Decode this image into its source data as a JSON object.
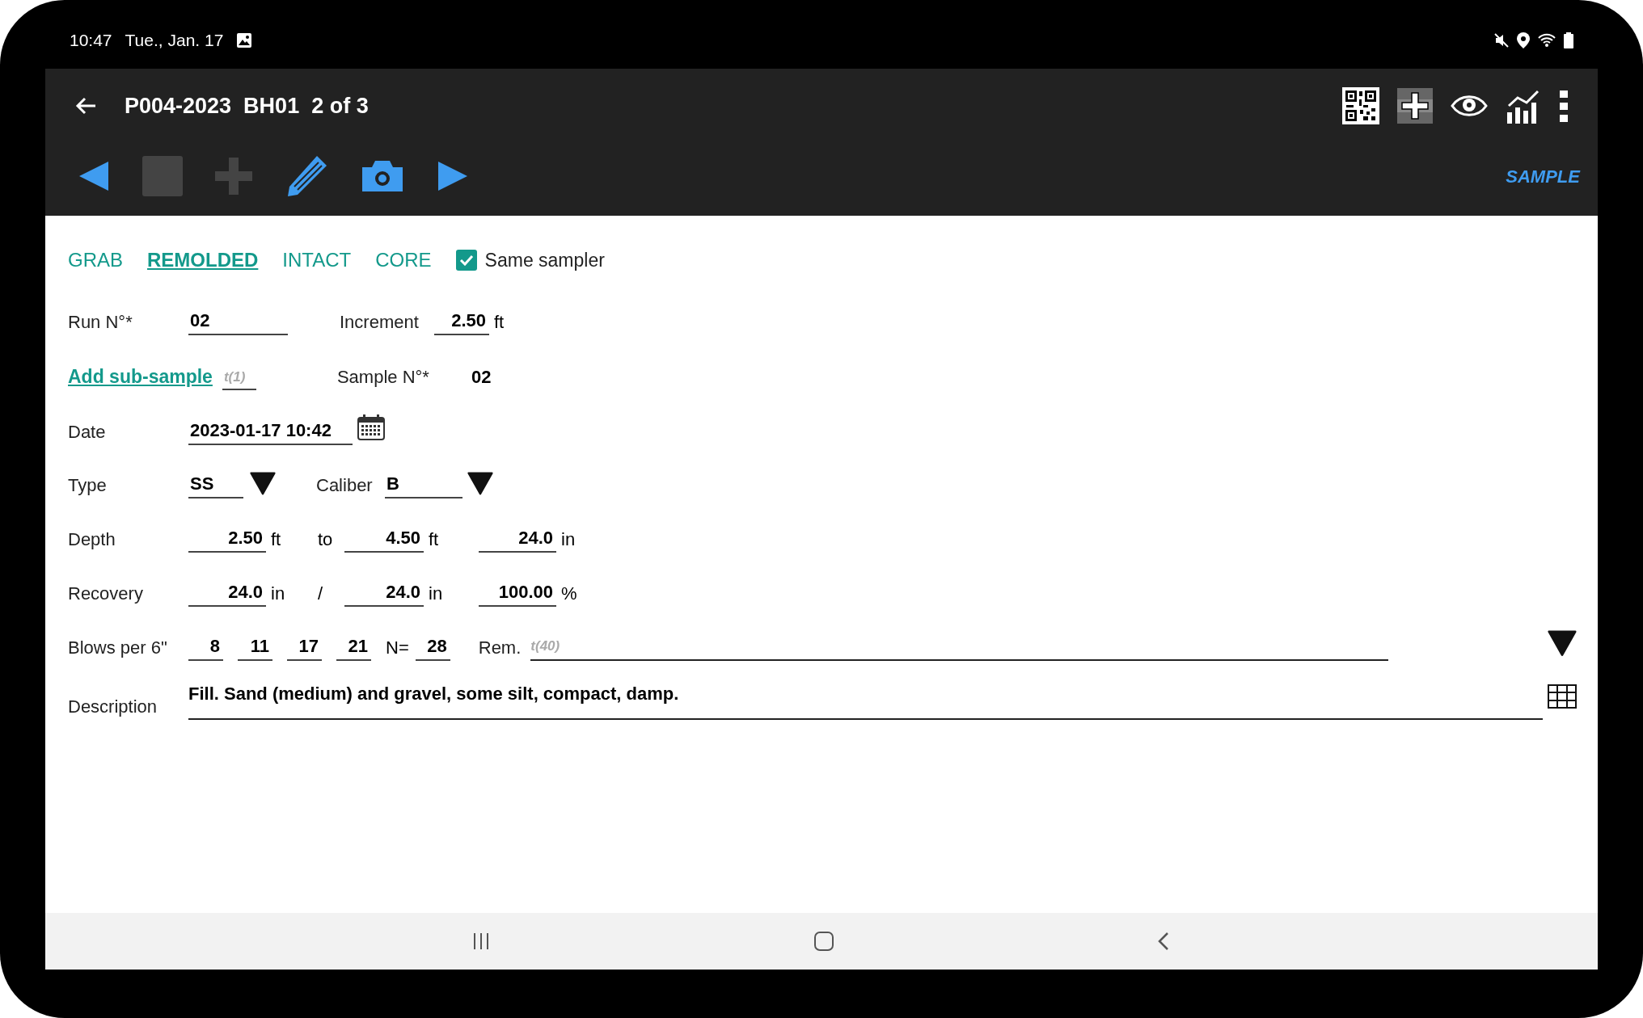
{
  "status_bar": {
    "time": "10:47",
    "date": "Tue., Jan. 17"
  },
  "app_bar": {
    "title": "P004-2023  BH01  2 of 3"
  },
  "toolbar": {
    "tools": [
      {
        "kind": "previous",
        "disabled": false
      },
      {
        "kind": "stop",
        "disabled": true
      },
      {
        "kind": "add",
        "disabled": true
      },
      {
        "kind": "edit",
        "disabled": false
      },
      {
        "kind": "camera",
        "disabled": false
      },
      {
        "kind": "next",
        "disabled": false
      }
    ],
    "mode_label": "SAMPLE"
  },
  "sample_types": [
    {
      "label": "GRAB",
      "selected": false
    },
    {
      "label": "REMOLDED",
      "selected": true
    },
    {
      "label": "INTACT",
      "selected": false
    },
    {
      "label": "CORE",
      "selected": false
    }
  ],
  "same_sampler": {
    "label": "Same sampler",
    "checked": true
  },
  "run": {
    "label": "Run N°*",
    "value": "02"
  },
  "increment": {
    "label": "Increment",
    "value": "2.50",
    "unit": "ft"
  },
  "sub_sample": {
    "link": "Add sub-sample",
    "placeholder": "t(1)"
  },
  "sample_no": {
    "label": "Sample N°*",
    "value": "02"
  },
  "date": {
    "label": "Date",
    "value": "2023-01-17 10:42"
  },
  "type": {
    "label": "Type",
    "value": "SS"
  },
  "caliber": {
    "label": "Caliber",
    "value": "B"
  },
  "depth": {
    "label": "Depth",
    "from": {
      "value": "2.50",
      "unit": "ft"
    },
    "separator": "to",
    "to": {
      "value": "4.50",
      "unit": "ft"
    },
    "length": {
      "value": "24.0",
      "unit": "in"
    }
  },
  "recovery": {
    "label": "Recovery",
    "from": {
      "value": "24.0",
      "unit": "in"
    },
    "separator": "/",
    "to": {
      "value": "24.0",
      "unit": "in"
    },
    "length": {
      "value": "100.00",
      "unit": "%"
    }
  },
  "blows": {
    "label": "Blows per 6\"",
    "values": [
      "8",
      "11",
      "17",
      "21"
    ],
    "n_label": "N=",
    "n_value": "28",
    "remark_label": "Rem.",
    "remark_placeholder": "t(40)"
  },
  "description": {
    "label": "Description",
    "value": "Fill. Sand (medium) and gravel, some silt, compact, damp."
  }
}
